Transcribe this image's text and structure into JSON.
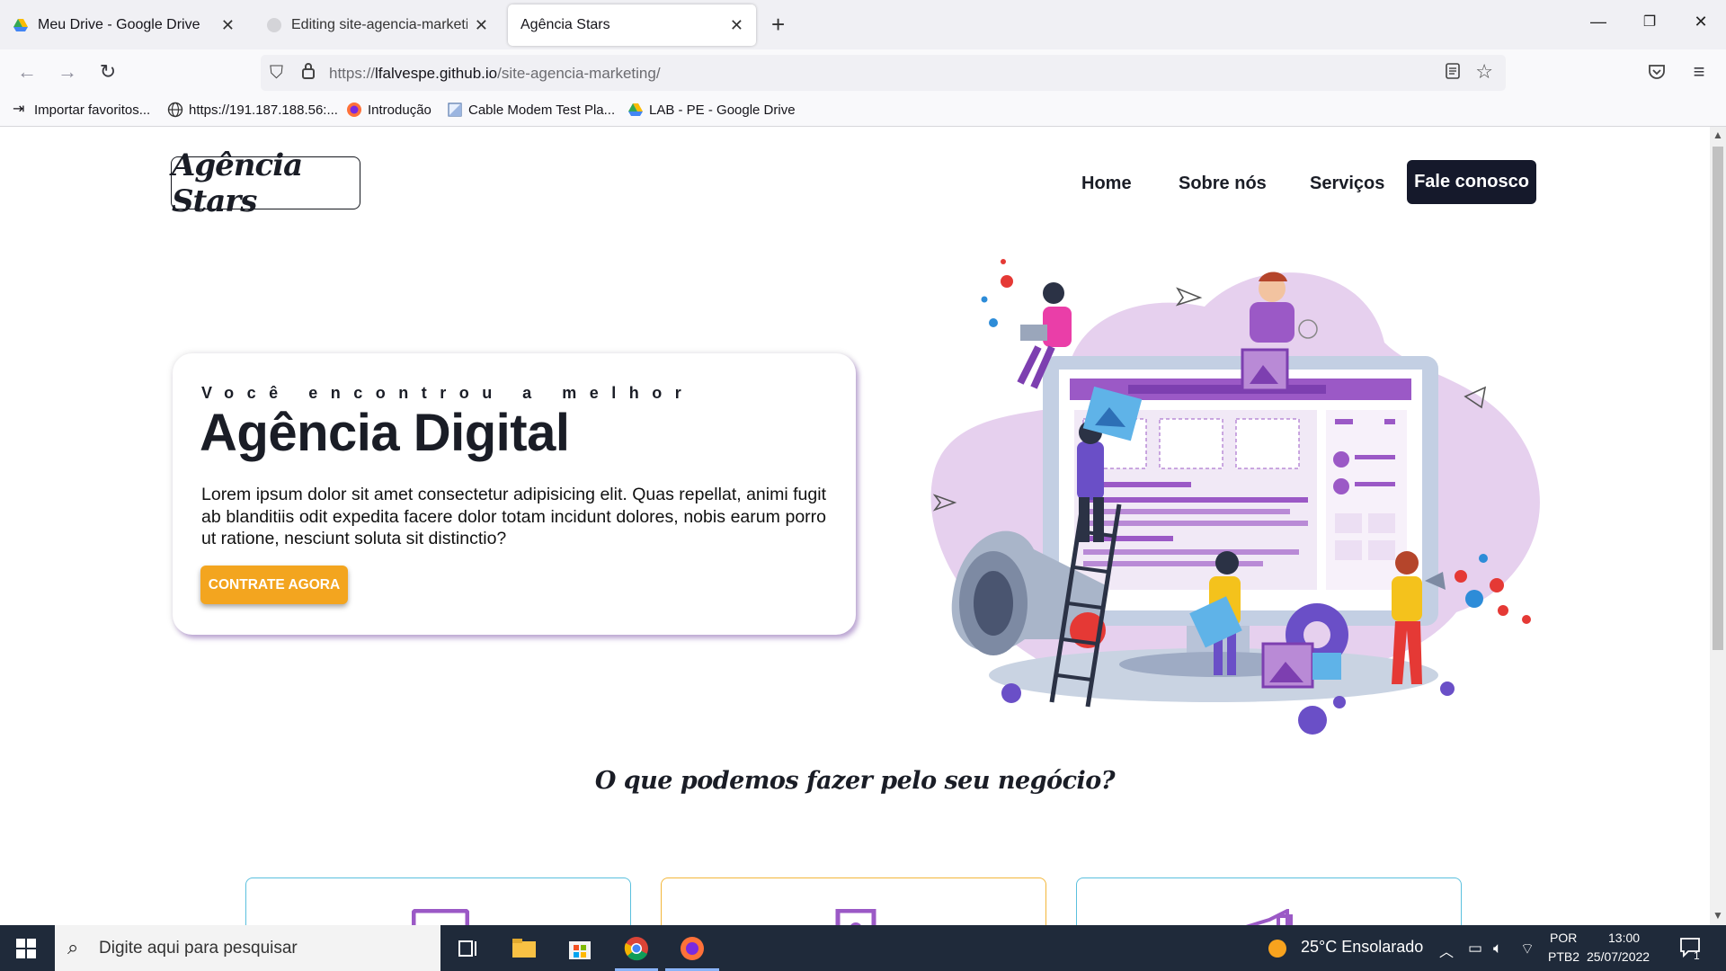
{
  "browser": {
    "tabs": [
      {
        "title": "Meu Drive - Google Drive",
        "active": false
      },
      {
        "title": "Editing site-agencia-marketing/",
        "active": false
      },
      {
        "title": "Agência Stars",
        "active": true
      }
    ],
    "url_prefix": "https://",
    "url_host": "lfalvespe.github.io",
    "url_path": "/site-agencia-marketing/",
    "bookmarks": [
      {
        "label": "Importar favoritos...",
        "icon": "import-icon"
      },
      {
        "label": "https://191.187.188.56:...",
        "icon": "globe-icon"
      },
      {
        "label": "Introdução",
        "icon": "firefox-icon"
      },
      {
        "label": "Cable Modem Test Pla...",
        "icon": "page-icon"
      },
      {
        "label": "LAB - PE - Google Drive",
        "icon": "google-drive-icon"
      }
    ]
  },
  "site": {
    "logo": "Agência Stars",
    "nav": {
      "home": "Home",
      "about": "Sobre nós",
      "services": "Serviços",
      "contact": "Fale conosco"
    },
    "hero": {
      "kicker": "Você encontrou a melhor",
      "title": "Agência Digital",
      "text": "Lorem ipsum dolor sit amet consectetur adipisicing elit. Quas repellat, animi fugit ab blanditiis odit expedita facere dolor totam incidunt dolores, nobis earum porro ut ratione, nesciunt soluta sit distinctio?",
      "button": "CONTRATE AGORA"
    },
    "services_title": "O que podemos fazer pelo seu negócio?",
    "service_cards": [
      {
        "icon": "monitor-icon",
        "border": "#5bc0de"
      },
      {
        "icon": "palette-icon",
        "border": "#f3b73b"
      },
      {
        "icon": "megaphone-icon",
        "border": "#5bc0de"
      }
    ],
    "colors": {
      "primary_dark": "#15192b",
      "accent_yellow": "#f3a51f",
      "accent_purple": "#9b59b6"
    }
  },
  "taskbar": {
    "search_placeholder": "Digite aqui para pesquisar",
    "weather": "25°C  Ensolarado",
    "lang_top": "POR",
    "lang_bottom": "PTB2",
    "time": "13:00",
    "date": "25/07/2022",
    "notifications": "1"
  }
}
